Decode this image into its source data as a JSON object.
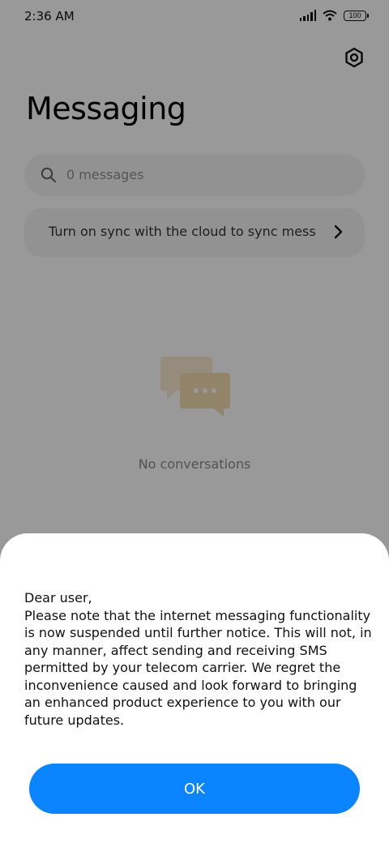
{
  "status_bar": {
    "time": "2:36 AM",
    "battery": "100",
    "icons": [
      "signal-icon",
      "wifi-icon",
      "battery-icon"
    ]
  },
  "header": {
    "title": "Messaging",
    "settings_icon": "settings-icon"
  },
  "search": {
    "placeholder": "0 messages",
    "icon": "search-icon"
  },
  "sync_banner": {
    "text": "Turn on sync with the cloud to sync messages",
    "icon": "chevron-right-icon"
  },
  "empty_state": {
    "icon": "chat-bubbles-icon",
    "text": "No conversations"
  },
  "dialog": {
    "greeting": "Dear user,",
    "body": "Please note that the internet messaging functionality is now suspended until further notice. This will not, in any manner, affect sending and receiving SMS permitted by your telecom carrier. We regret the inconvenience caused and look forward to bringing an enhanced product experience to you with our future updates.",
    "ok_label": "OK"
  },
  "colors": {
    "accent": "#0a84ff",
    "scrim": "rgba(0,0,0,0.40)",
    "surface": "#f4f4f4",
    "illustration": "#f3dcae"
  }
}
